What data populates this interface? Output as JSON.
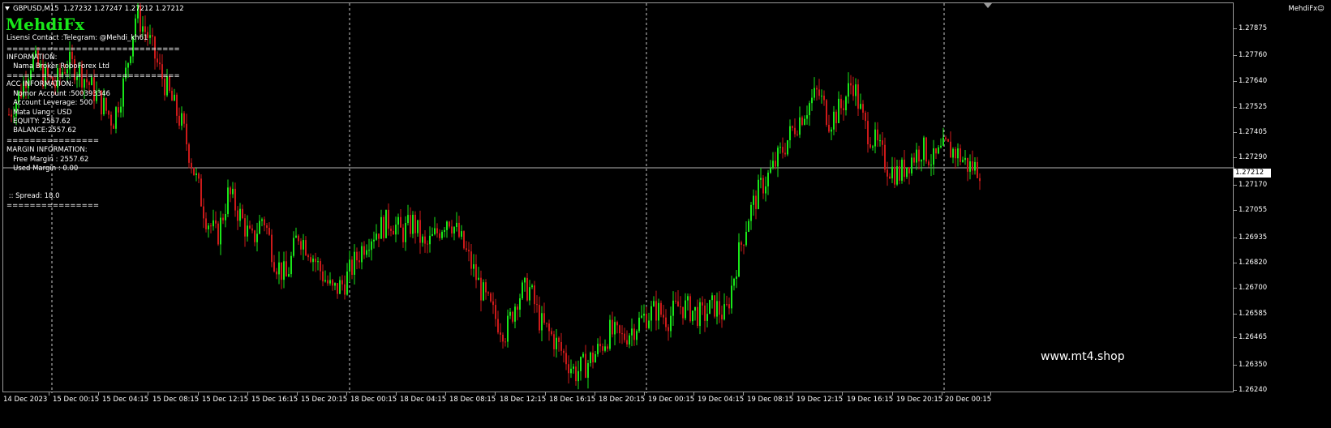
{
  "header": {
    "symbol": "GBPUSD,M15",
    "quote": "1.27232 1.27247 1.27212 1.27212",
    "ea_name": "MehdiFx",
    "smiley": "☺"
  },
  "panel": {
    "brand": "MehdiFx",
    "lines": [
      "Lisensi Contact :Telegram: @Mehdi_kh61",
      "==============================",
      "INFORMATION:",
      "   Nama Broker RoboForex Ltd",
      "==============================",
      "ACC INFORMATION:",
      "   Nomor Account :500393346",
      "   Account Leverage: 500",
      "   Mata Uang : USD",
      "   EQUITY: 2557.62",
      "   BALANCE:2557.62",
      "================",
      "MARGIN INFORMATION:",
      "   Free Margin : 2557.62",
      "   Used Margin : 0.00",
      "",
      " :: Spread: 18.0",
      "================"
    ]
  },
  "watermark": "www.mt4.shop",
  "current_price": "1.27212",
  "colors": {
    "background": "#000000",
    "bull": "#19e619",
    "bear": "#cc1a1a",
    "grid": "#c8c8c8",
    "brand": "#19e619"
  },
  "chart_data": {
    "type": "candlestick",
    "symbol": "GBPUSD",
    "timeframe": "M15",
    "grid": "vertical dashed separators",
    "ylim": [
      1.2622,
      1.2793
    ],
    "y_ticks": [
      "1.27875",
      "1.27760",
      "1.27640",
      "1.27525",
      "1.27405",
      "1.27290",
      "1.27170",
      "1.27055",
      "1.26935",
      "1.26820",
      "1.26700",
      "1.26585",
      "1.26465",
      "1.26350",
      "1.26240"
    ],
    "x_ticks": [
      "14 Dec 2023",
      "15 Dec 00:15",
      "15 Dec 04:15",
      "15 Dec 08:15",
      "15 Dec 12:15",
      "15 Dec 16:15",
      "15 Dec 20:15",
      "18 Dec 00:15",
      "18 Dec 04:15",
      "18 Dec 08:15",
      "18 Dec 12:15",
      "18 Dec 16:15",
      "18 Dec 20:15",
      "19 Dec 00:15",
      "19 Dec 04:15",
      "19 Dec 08:15",
      "19 Dec 12:15",
      "19 Dec 16:15",
      "19 Dec 20:15",
      "20 Dec 00:15"
    ],
    "day_separators": [
      "15 Dec",
      "18 Dec",
      "19 Dec",
      "20 Dec"
    ],
    "close_path": [
      1.2745,
      1.2755,
      1.277,
      1.2762,
      1.2758,
      1.2768,
      1.2765,
      1.2758,
      1.275,
      1.2742,
      1.276,
      1.279,
      1.278,
      1.2765,
      1.2752,
      1.274,
      1.272,
      1.27,
      1.269,
      1.271,
      1.27,
      1.2688,
      1.27,
      1.268,
      1.2672,
      1.2692,
      1.2685,
      1.2675,
      1.2666,
      1.267,
      1.268,
      1.269,
      1.2694,
      1.2698,
      1.2692,
      1.2697,
      1.2685,
      1.2692,
      1.27,
      1.269,
      1.2678,
      1.2665,
      1.2655,
      1.2648,
      1.2664,
      1.2668,
      1.2652,
      1.2646,
      1.2638,
      1.263,
      1.2634,
      1.264,
      1.2648,
      1.2645,
      1.265,
      1.2655,
      1.2658,
      1.2654,
      1.266,
      1.2658,
      1.2655,
      1.266,
      1.2655,
      1.268,
      1.27,
      1.2712,
      1.272,
      1.273,
      1.274,
      1.2748,
      1.2755,
      1.2742,
      1.2748,
      1.276,
      1.274,
      1.2732,
      1.2722,
      1.2718,
      1.2725,
      1.273,
      1.2724,
      1.273,
      1.2728,
      1.2722,
      1.2721
    ]
  }
}
